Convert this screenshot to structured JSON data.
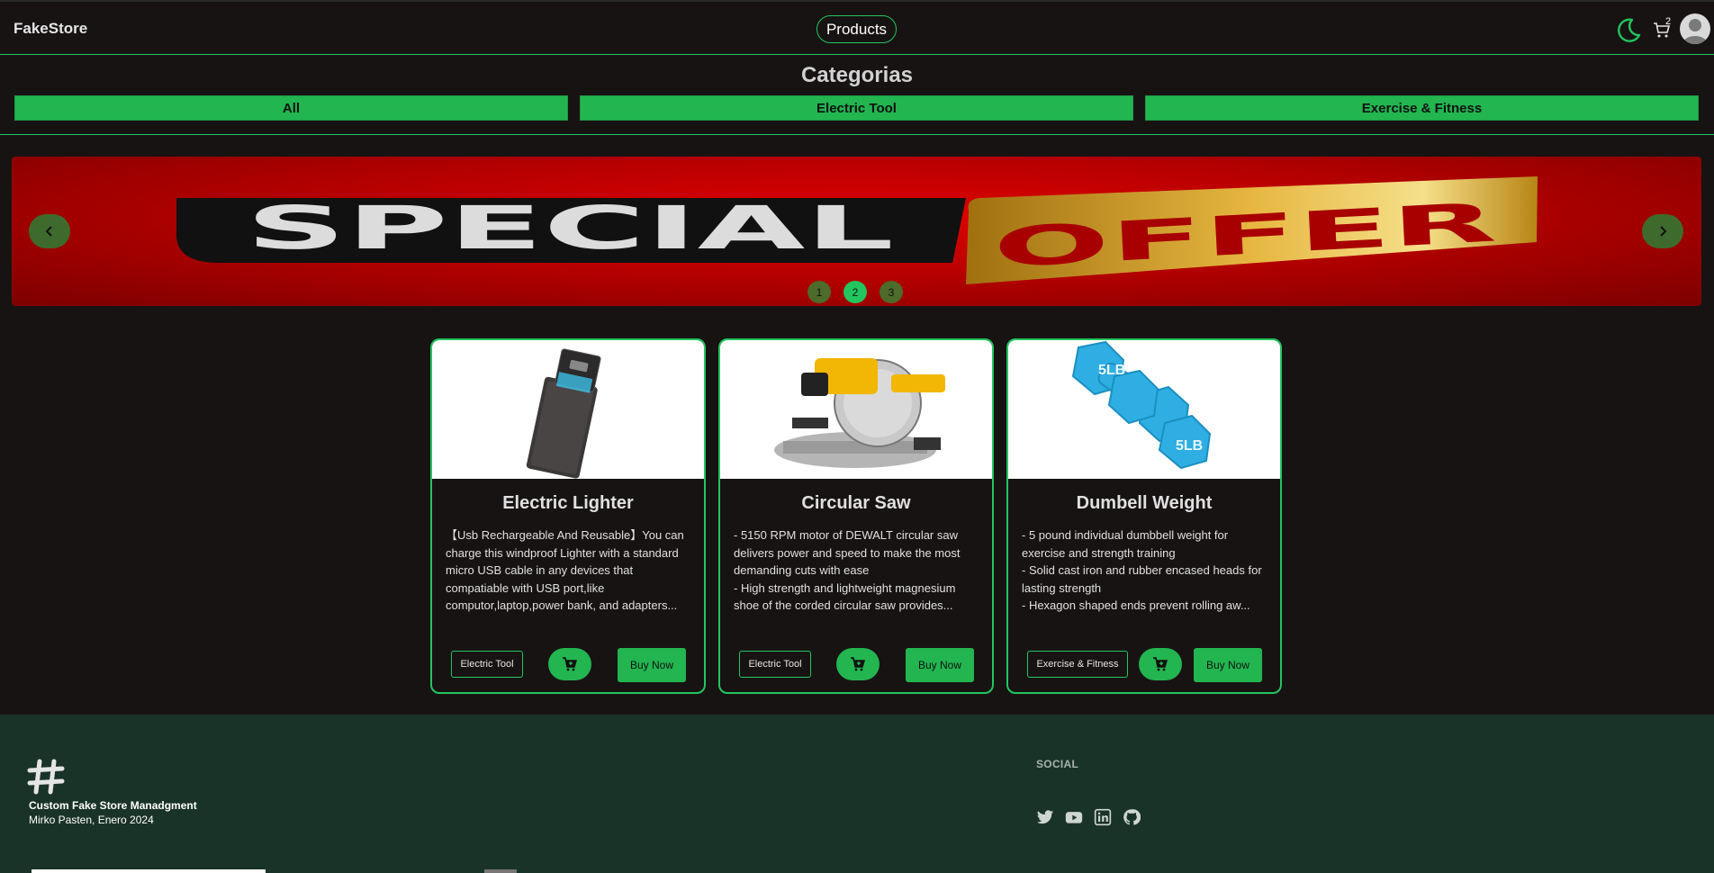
{
  "header": {
    "brand": "FakeStore",
    "nav_products": "Products",
    "cart_count": "2"
  },
  "categories": {
    "title": "Categorias",
    "items": [
      {
        "label": "All"
      },
      {
        "label": "Electric Tool"
      },
      {
        "label": "Exercise & Fitness"
      }
    ]
  },
  "carousel": {
    "banner_text_1": "SPECIAL",
    "banner_text_2": "OFFER",
    "indicators": [
      "1",
      "2",
      "3"
    ],
    "active_indicator": "2"
  },
  "products": [
    {
      "title": "Electric Lighter",
      "description": "【Usb Rechargeable And Reusable】You can charge this windproof Lighter with a standard micro USB cable in any devices that compatiable with USB port,like computor,laptop,power bank, and adapters...",
      "category": "Electric Tool",
      "buy_label": "Buy Now"
    },
    {
      "title": "Circular Saw",
      "description": "- 5150 RPM motor of DEWALT circular saw delivers power and speed to make the most demanding cuts with ease\n- High strength and lightweight magnesium shoe of the corded circular saw provides...",
      "category": "Electric Tool",
      "buy_label": "Buy Now"
    },
    {
      "title": "Dumbell Weight",
      "description": "- 5 pound individual dumbbell weight for exercise and strength training\n- Solid cast iron and rubber encased heads for lasting strength\n- Hexagon shaped ends prevent rolling aw...",
      "category": "Exercise & Fitness",
      "buy_label": "Buy Now"
    }
  ],
  "footer": {
    "company": "Custom Fake Store Manadgment",
    "author": "Mirko Pasten, Enero 2024",
    "social_heading": "SOCIAL",
    "social_icons": [
      "twitter-icon",
      "youtube-icon",
      "linkedin-icon",
      "github-icon"
    ]
  },
  "colors": {
    "accent": "#22c55e",
    "background": "#181313",
    "footer": "#1a3328",
    "banner_red": "#c00000"
  }
}
